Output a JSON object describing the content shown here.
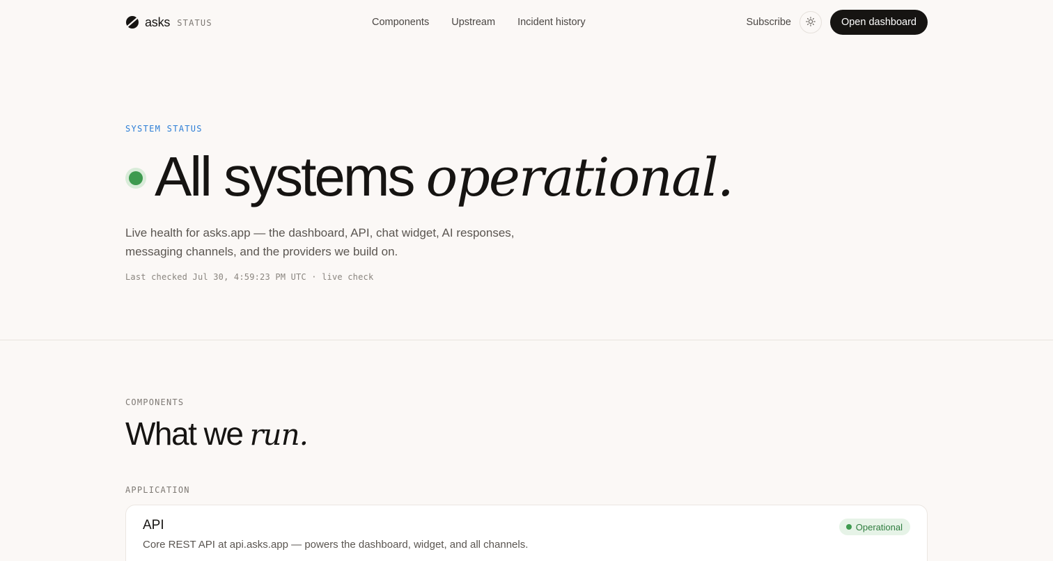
{
  "header": {
    "brand_name": "asks",
    "brand_tag": "STATUS",
    "logo_icon": "slashed-circle-logo",
    "nav": [
      {
        "label": "Components"
      },
      {
        "label": "Upstream"
      },
      {
        "label": "Incident history"
      }
    ],
    "subscribe_label": "Subscribe",
    "theme_icon": "sun-icon",
    "cta_label": "Open dashboard"
  },
  "hero": {
    "eyebrow": "SYSTEM STATUS",
    "title_plain": "All systems",
    "title_italic": "operational.",
    "description": "Live health for asks.app — the dashboard, API, chat widget, AI responses, messaging channels, and the providers we build on.",
    "last_checked": "Last checked Jul 30, 4:59:23 PM UTC · live check",
    "status_color": "#3e9a4f"
  },
  "components": {
    "eyebrow": "COMPONENTS",
    "title_plain": "What we",
    "title_italic": "run.",
    "groups": [
      {
        "label": "APPLICATION",
        "items": [
          {
            "name": "API",
            "description": "Core REST API at api.asks.app — powers the dashboard, widget, and all channels.",
            "status": "Operational"
          }
        ]
      }
    ]
  },
  "colors": {
    "accent_blue": "#2d7ed6",
    "operational_green": "#3e9a4f",
    "background": "#fbf8f6",
    "ink": "#161412"
  }
}
